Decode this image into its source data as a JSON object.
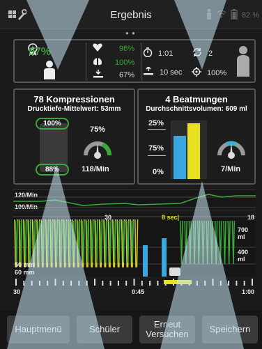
{
  "header": {
    "title": "Ergebnis",
    "battery_label": "82 %"
  },
  "summary": {
    "score": "97%",
    "heart_value": "96%",
    "lungs_value": "100%",
    "hands_value": "67%",
    "time_value": "1:01",
    "cycles_value": "2",
    "pause_value": "10 sec",
    "target_value": "100%"
  },
  "compressions": {
    "title": "78 Kompressionen",
    "subtitle": "Drucktiefe-Mittelwert: 53mm",
    "top_pill": "100%",
    "bottom_pill": "88%",
    "gauge_pct": "75%",
    "rate": "118/Min"
  },
  "ventilations": {
    "title": "4 Beatmungen",
    "subtitle": "Durchschnittsvolumen: 609 ml",
    "tick_top": "25%",
    "tick_mid": "75%",
    "tick_bottom": "0%",
    "rate": "7/Min"
  },
  "rate_graph": {
    "label_top": "120/Min",
    "label_bottom": "100/Min"
  },
  "wave": {
    "mark_30": "30",
    "mark_8sec": "8 sec|",
    "mark_18": "18",
    "vol_700": "700 ml",
    "vol_400": "400 ml",
    "depth_50": "50 mm",
    "depth_60": "60 mm"
  },
  "timeline": {
    "start": "30",
    "mid": "0:45",
    "end": "1:00"
  },
  "buttons": {
    "main_menu": "Hauptmenü",
    "students": "Schüler",
    "retry": "Erneut Versuchen",
    "save": "Speichern"
  },
  "colors": {
    "green": "#3aa83a",
    "yellow": "#e8e020",
    "blue": "#3aa8e0"
  }
}
